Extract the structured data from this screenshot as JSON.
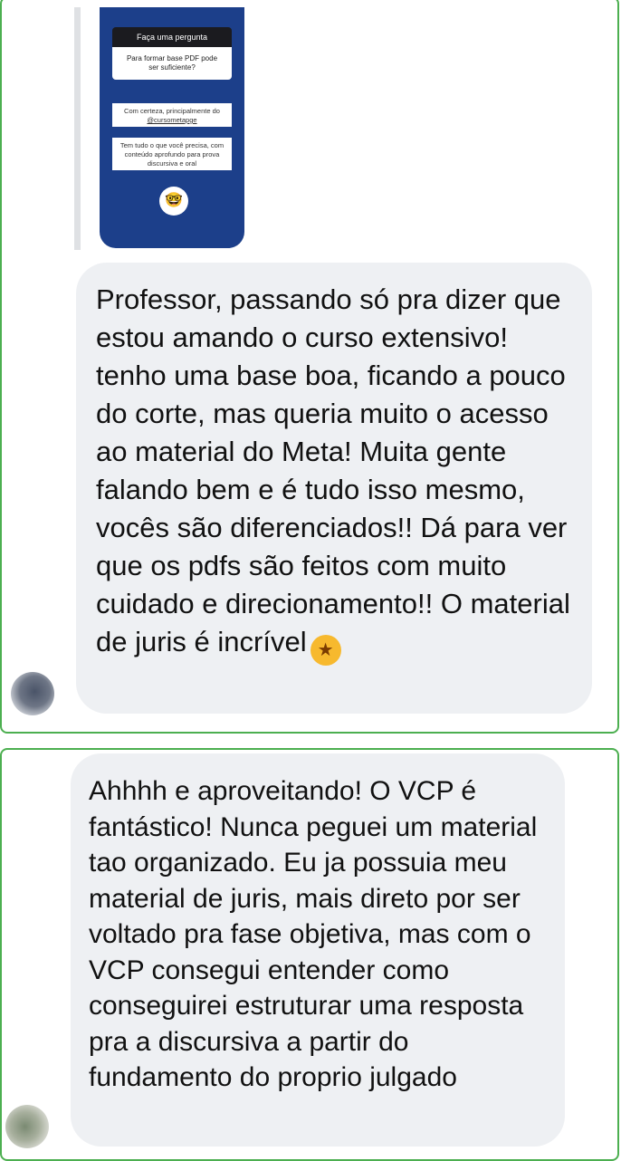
{
  "story": {
    "title": "Faça uma pergunta",
    "question": "Para formar base PDF pode ser suficiente?",
    "answer1_text": "Com certeza, principalmente do",
    "answer1_handle": "@cursometapge",
    "answer2": "Tem tudo o que você precisa, com conteúdo aprofundo para prova discursiva e oral",
    "sticker_icon": "nerd-face-emoji"
  },
  "messages": [
    {
      "text": "Professor, passando só pra dizer que estou amando o curso extensivo! tenho uma base boa, ficando a pouco do corte, mas queria muito o acesso ao material do Meta! Muita gente falando bem e é tudo isso mesmo, vocês são diferenciados!! Dá para ver que os pdfs são feitos com muito cuidado e direcionamento!! O material de juris é incrível",
      "emoji": "star-struck-emoji"
    },
    {
      "text": "Ahhhh e aproveitando! O VCP é fantástico! Nunca peguei um material tao organizado. Eu ja possuia meu material de juris, mais direto por ser voltado pra fase objetiva, mas com o VCP consegui entender como conseguirei estruturar uma resposta pra a discursiva a partir do fundamento do proprio julgado"
    }
  ],
  "colors": {
    "border": "#4caf50",
    "bubble": "#eef0f3",
    "story_bg": "#1c3f8a"
  }
}
